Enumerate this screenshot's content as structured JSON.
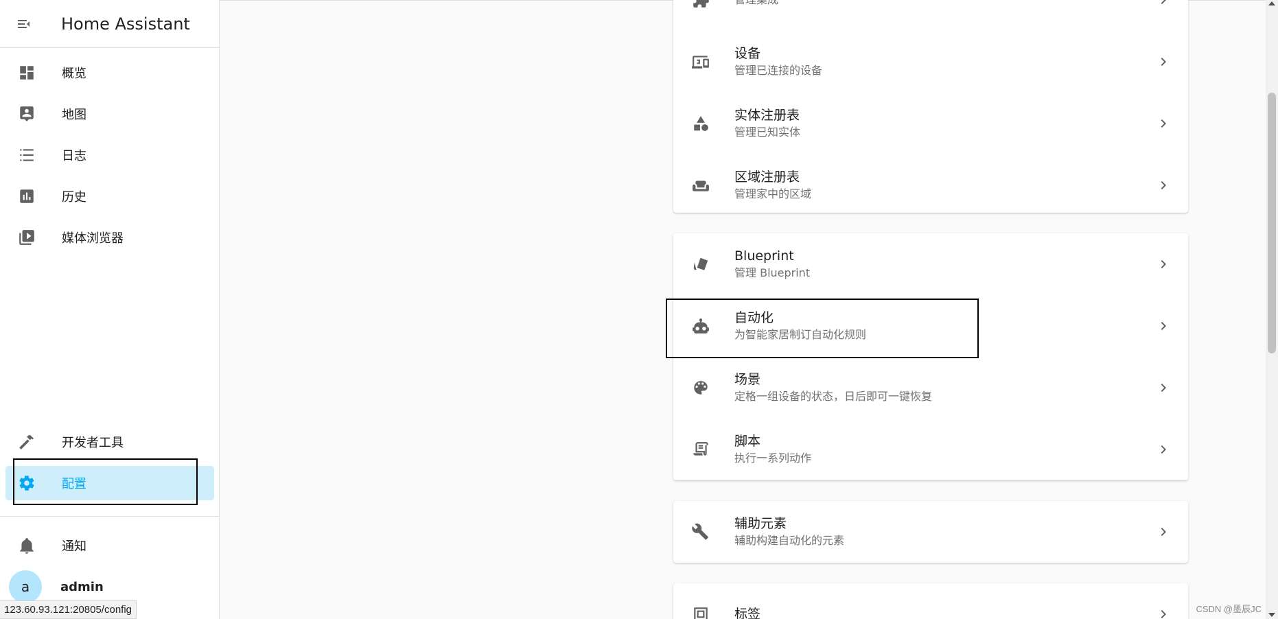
{
  "sidebar": {
    "title": "Home Assistant",
    "items": [
      {
        "label": "概览",
        "icon": "dashboard-icon"
      },
      {
        "label": "地图",
        "icon": "map-account-icon"
      },
      {
        "label": "日志",
        "icon": "format-list-icon"
      },
      {
        "label": "历史",
        "icon": "chart-box-icon"
      },
      {
        "label": "媒体浏览器",
        "icon": "play-box-multiple-icon"
      },
      {
        "label": "开发者工具",
        "icon": "hammer-icon"
      },
      {
        "label": "配置",
        "icon": "cog-icon"
      },
      {
        "label": "通知",
        "icon": "bell-icon"
      }
    ],
    "user": {
      "avatar_letter": "a",
      "name": "admin"
    },
    "accent": "#03a9f4"
  },
  "status_url": "123.60.93.121:20805/config",
  "cards": [
    {
      "rows": [
        {
          "primary": "",
          "secondary": "管理集成",
          "icon": "puzzle-icon"
        },
        {
          "primary": "设备",
          "secondary": "管理已连接的设备",
          "icon": "devices-icon"
        },
        {
          "primary": "实体注册表",
          "secondary": "管理已知实体",
          "icon": "shape-icon"
        },
        {
          "primary": "区域注册表",
          "secondary": "管理家中的区域",
          "icon": "sofa-icon"
        }
      ]
    },
    {
      "rows": [
        {
          "primary": "Blueprint",
          "secondary": "管理 Blueprint",
          "icon": "paper-cut-icon"
        },
        {
          "primary": "自动化",
          "secondary": "为智能家居制订自动化规则",
          "icon": "robot-icon"
        },
        {
          "primary": "场景",
          "secondary": "定格一组设备的状态，日后即可一键恢复",
          "icon": "palette-icon"
        },
        {
          "primary": "脚本",
          "secondary": "执行一系列动作",
          "icon": "script-text-icon"
        }
      ]
    },
    {
      "rows": [
        {
          "primary": "辅助元素",
          "secondary": "辅助构建自动化的元素",
          "icon": "tools-icon"
        }
      ]
    },
    {
      "rows": [
        {
          "primary": "标签",
          "secondary": "",
          "icon": "tag-icon"
        }
      ]
    }
  ],
  "watermark": "CSDN @墨辰JC"
}
